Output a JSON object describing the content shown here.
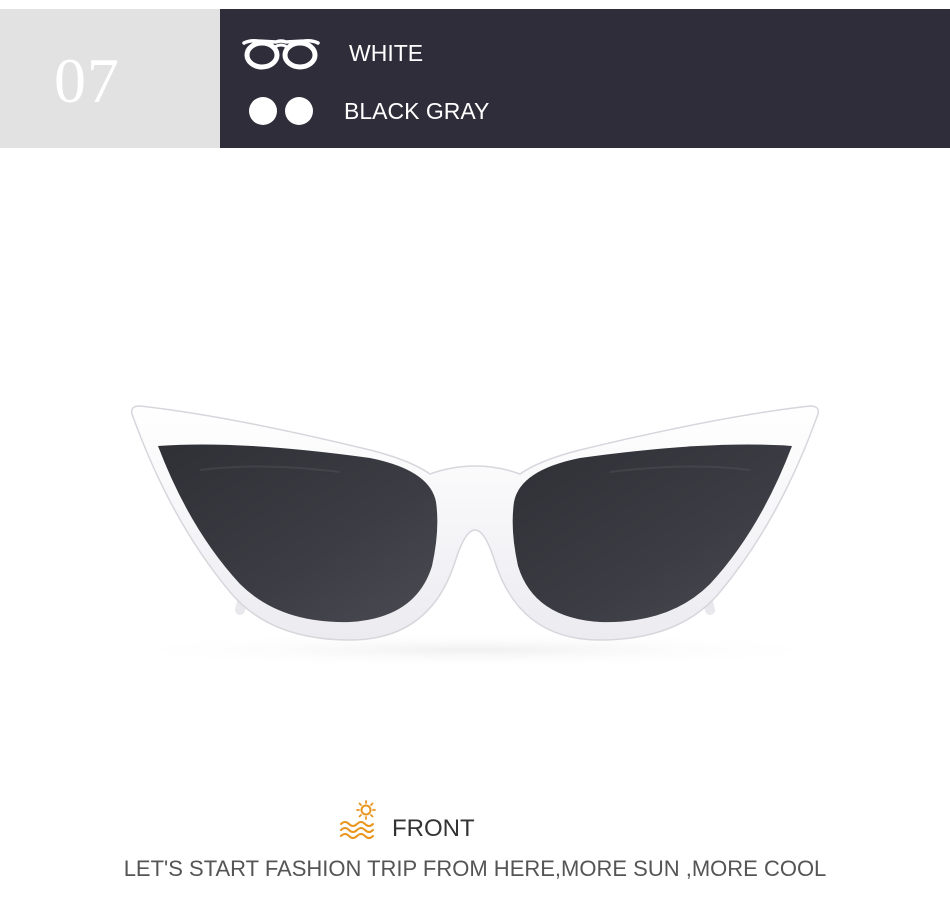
{
  "header": {
    "number": "07",
    "frame_color": {
      "label": "WHITE",
      "icon": "glasses-frame-icon"
    },
    "lens_color": {
      "label": "BLACK GRAY",
      "icon": "lens-pair-icon"
    }
  },
  "product": {
    "image": "cat-eye-sunglasses-white-frame-gray-lens",
    "frame_hex": "#f4f3f6",
    "lens_hex": "#3a3b41"
  },
  "footer": {
    "icon": "sun-waves-icon",
    "title": "FRONT",
    "tagline": "LET'S START FASHION TRIP FROM HERE,MORE SUN ,MORE COOL"
  },
  "colors": {
    "header_dark": "#302d3b",
    "header_light": "#e2e2e2",
    "accent_orange": "#e8961e"
  }
}
